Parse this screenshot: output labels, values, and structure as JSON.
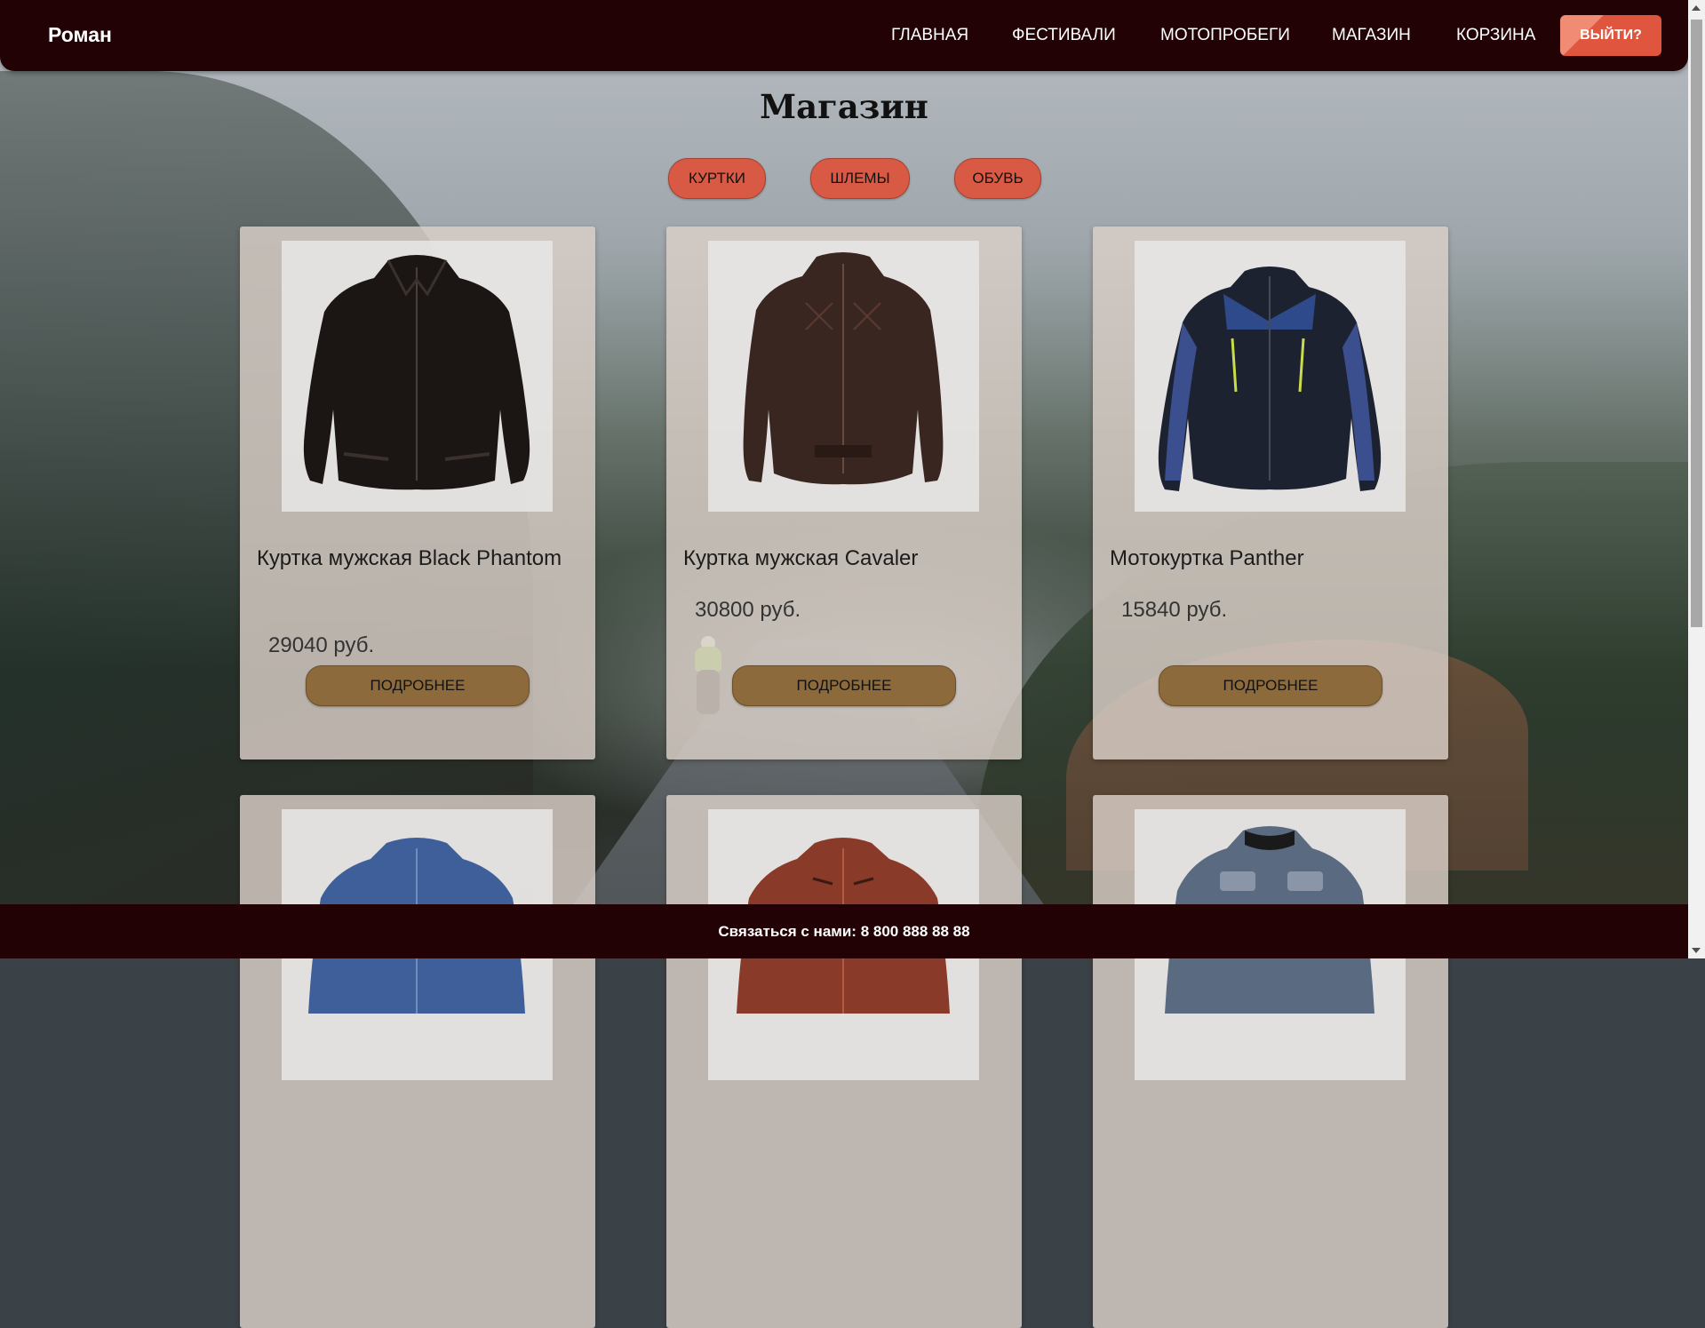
{
  "header": {
    "brand": "Роман",
    "nav": [
      "ГЛАВНАЯ",
      "ФЕСТИВАЛИ",
      "МОТОПРОБЕГИ",
      "МАГАЗИН",
      "КОРЗИНА"
    ],
    "logout_label": "ВЫЙТИ?"
  },
  "page": {
    "title": "Магазин"
  },
  "filters": [
    "КУРТКИ",
    "ШЛЕМЫ",
    "ОБУВЬ"
  ],
  "products": [
    {
      "title": "Куртка мужская Black Phantom",
      "price": "29040 руб.",
      "button": "ПОДРОБНЕЕ",
      "image": "black-leather-jacket",
      "color": "#1b1614"
    },
    {
      "title": "Куртка мужская Cavaler",
      "price": "30800 руб.",
      "button": "ПОДРОБНЕЕ",
      "image": "brown-quilted-leather-jacket",
      "color": "#3a2620"
    },
    {
      "title": "Мотокуртка Panther",
      "price": "15840 руб.",
      "button": "ПОДРОБНЕЕ",
      "image": "black-blue-textile-moto-jacket",
      "color": "#1c2230"
    },
    {
      "image": "blue-denim-jacket",
      "color": "#3e5f9a"
    },
    {
      "image": "brown-red-leather-jacket",
      "color": "#8a3a28"
    },
    {
      "image": "blue-grey-patch-leather-jacket",
      "color": "#5a6a80"
    }
  ],
  "footer": {
    "contact": "Связаться с нами: 8 800 888 88 88"
  }
}
